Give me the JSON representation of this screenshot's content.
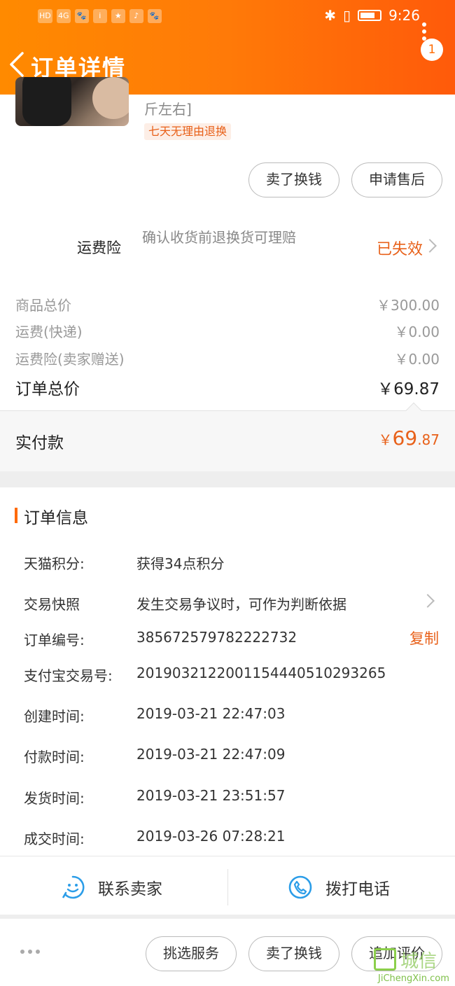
{
  "status_bar": {
    "left_icons": [
      "HD",
      "4G",
      "signal",
      "paw",
      "i",
      "star",
      "tiktok",
      "baidu"
    ],
    "time": "9:26"
  },
  "header": {
    "title": "订单详情",
    "notification_count": "1",
    "bg_color_start": "#ff8a00",
    "bg_color_end": "#ff5a0a"
  },
  "product": {
    "desc_tail": "斤左右]",
    "return_tag": "七天无理由退换",
    "actions": {
      "sell": "卖了换钱",
      "after_sale": "申请售后"
    }
  },
  "insurance": {
    "label": "运费险",
    "desc": "确认收货前退换货可理赔",
    "status": "已失效"
  },
  "prices": [
    {
      "label": "商品总价",
      "value": "￥300.00"
    },
    {
      "label": "运费(快递)",
      "value": "￥0.00"
    },
    {
      "label": "运费险(卖家赠送)",
      "value": "￥0.00"
    }
  ],
  "order_total": {
    "label": "订单总价",
    "value": "￥69.87"
  },
  "payment": {
    "label": "实付款",
    "currency": "￥",
    "int": "69",
    "dec": ".87"
  },
  "order_info": {
    "title": "订单信息",
    "rows": [
      {
        "key": "天猫积分:",
        "value": "获得34点积分"
      },
      {
        "key": "交易快照",
        "value": "发生交易争议时，可作为判断依据"
      },
      {
        "key": "订单编号:",
        "value": "385672579782222732"
      },
      {
        "key": "支付宝交易号:",
        "value": "2019032122001154440510293265"
      },
      {
        "key": "创建时间:",
        "value": "2019-03-21 22:47:03"
      },
      {
        "key": "付款时间:",
        "value": "2019-03-21 22:47:09"
      },
      {
        "key": "发货时间:",
        "value": "2019-03-21 23:51:57"
      },
      {
        "key": "成交时间:",
        "value": "2019-03-26 07:28:21"
      }
    ],
    "copy_label": "复制"
  },
  "contact": {
    "seller": "联系卖家",
    "phone": "拨打电话"
  },
  "bottom_bar": {
    "choose_service": "挑选服务",
    "sell": "卖了换钱",
    "add_review": "追加评价"
  },
  "watermark": {
    "text": "城信",
    "url": "JiChengXin.com"
  },
  "colors": {
    "accent": "#e8611a",
    "brand": "#ff6a00"
  }
}
